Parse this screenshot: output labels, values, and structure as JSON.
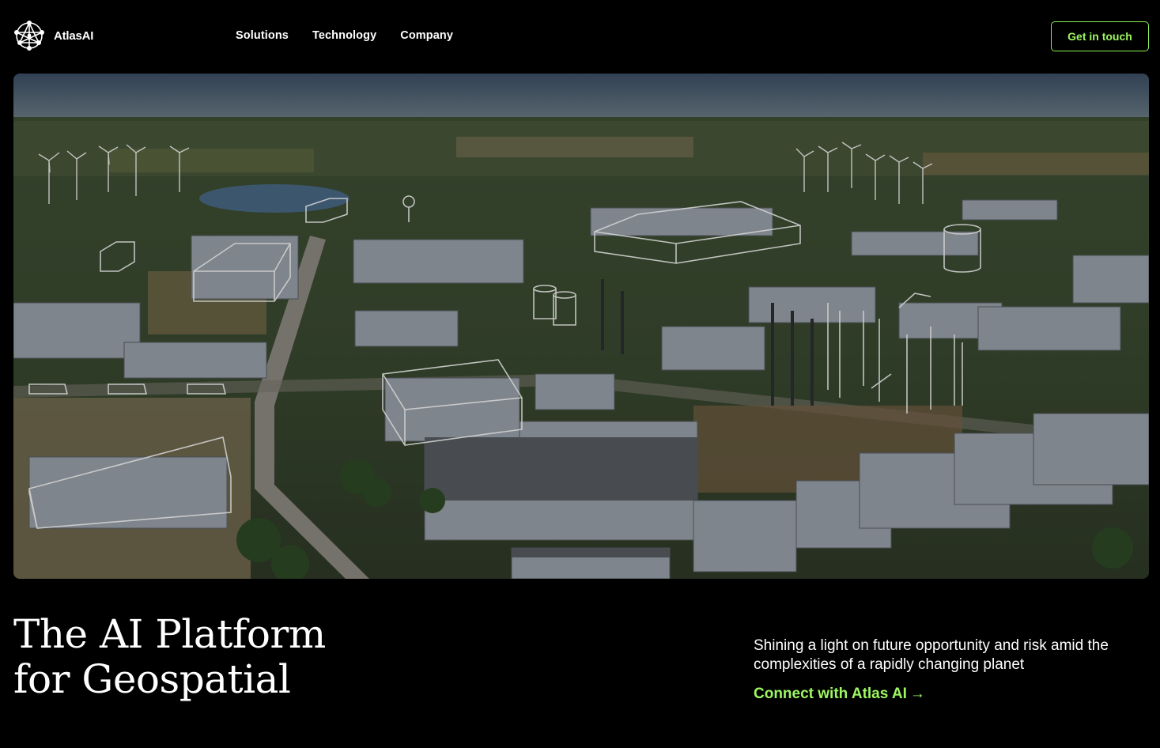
{
  "brand": {
    "name": "AtlasAI",
    "icon": "atlas-network-icon"
  },
  "nav": {
    "links": [
      {
        "label": "Solutions"
      },
      {
        "label": "Technology"
      },
      {
        "label": "Company"
      }
    ],
    "cta_label": "Get in touch"
  },
  "hero": {
    "image_alt": "Aerial view of an industrial park with wind turbines",
    "icons": [
      "wind-turbine-icon",
      "outlined-building-icon",
      "storage-tank-icon"
    ]
  },
  "headline": {
    "line1": "The AI Platform",
    "line2": "for Geospatial"
  },
  "tagline": "Shining a light on future opportunity and risk amid the complexities of a rapidly changing planet",
  "connect": {
    "label": "Connect with Atlas AI",
    "arrow": "→"
  },
  "colors": {
    "background": "#000000",
    "accent": "#9ef761",
    "text": "#ffffff"
  }
}
